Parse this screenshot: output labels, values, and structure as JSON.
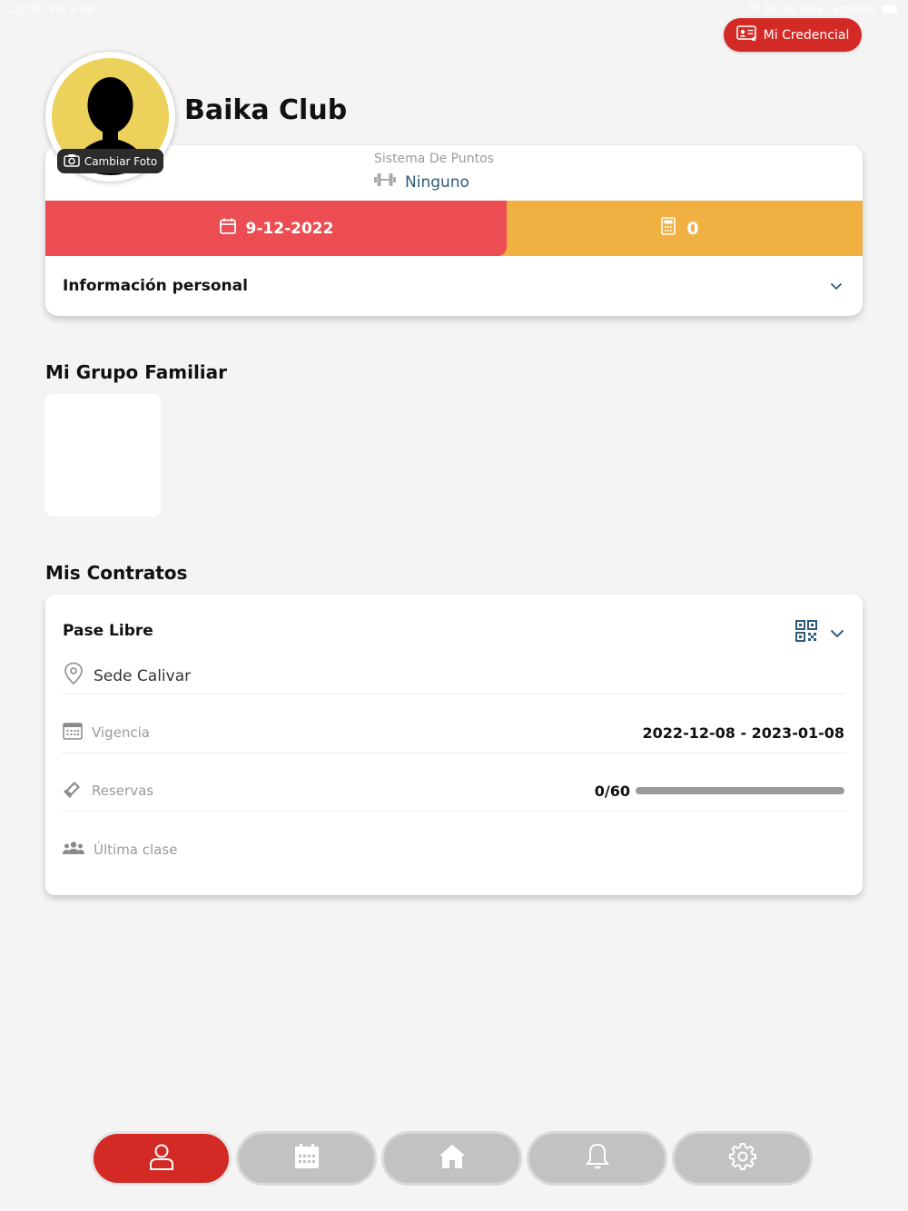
{
  "status_bar": {
    "time": "13:38",
    "date": "Vie 9 dic",
    "charging_text": "No se está cargando"
  },
  "header": {
    "credential_label": "Mi Credencial"
  },
  "profile": {
    "club_name": "Baika Club",
    "change_photo_label": "Cambiar Foto",
    "points_system_label": "Sistema De Puntos",
    "points_system_value": "Ninguno",
    "date": "9-12-2022",
    "count": "0",
    "personal_info_label": "Información personal"
  },
  "family": {
    "title": "Mi Grupo Familiar"
  },
  "contracts": {
    "title": "Mis Contratos",
    "items": [
      {
        "name": "Pase Libre",
        "location": "Sede Calivar",
        "validity_label": "Vigencia",
        "validity_value": "2022-12-08 - 2023-01-08",
        "reservations_label": "Reservas",
        "reservations_value": "0/60",
        "reservations_progress": 0,
        "last_class_label": "Última clase"
      }
    ]
  },
  "colors": {
    "primary": "#d42a26",
    "date_bg": "#eb4d52",
    "count_bg": "#f0b142",
    "nav_inactive": "#c2c2c2"
  },
  "nav": {
    "items": [
      {
        "icon": "user-icon",
        "active": true
      },
      {
        "icon": "calendar-icon",
        "active": false
      },
      {
        "icon": "home-icon",
        "active": false
      },
      {
        "icon": "bell-icon",
        "active": false
      },
      {
        "icon": "gear-icon",
        "active": false
      }
    ]
  }
}
